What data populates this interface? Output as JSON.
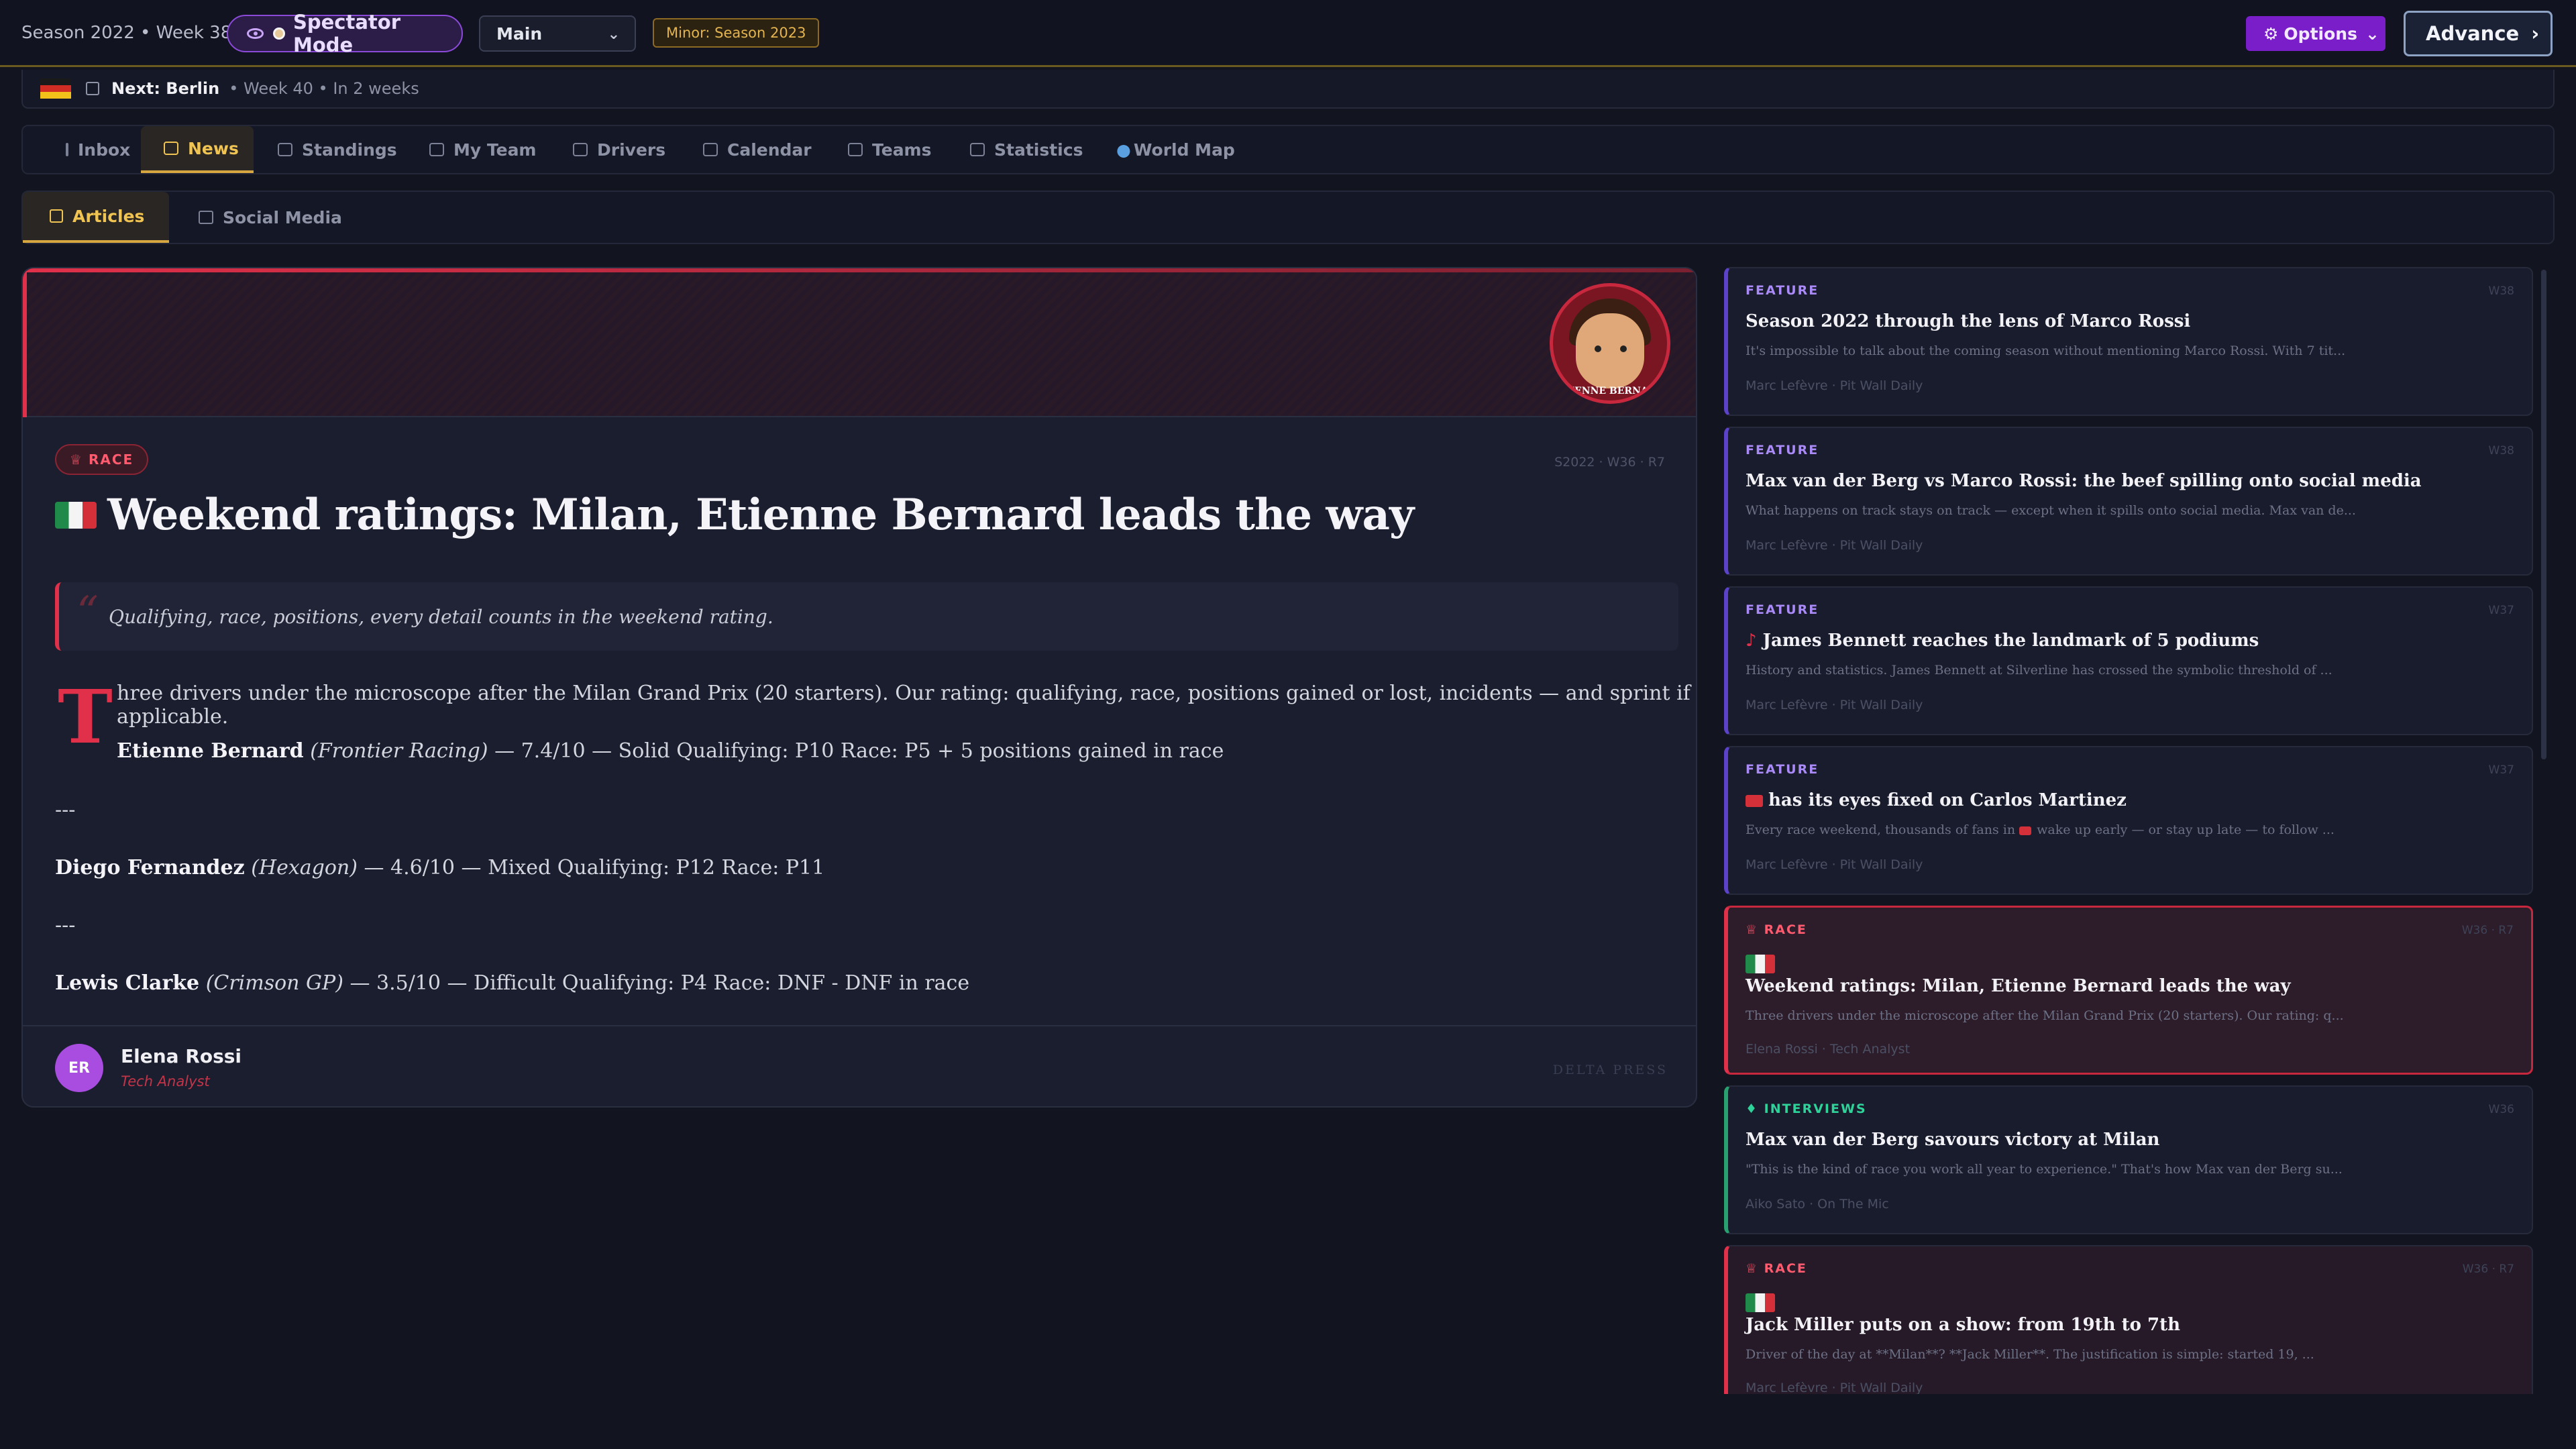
{
  "topbar": {
    "season": "Season 2022 • Week 38",
    "spectator_label": "Spectator Mode",
    "save_select": "Main",
    "minor_badge": "Minor: Season 2023",
    "options_label": "Options",
    "advance_label": "Advance"
  },
  "next_race": {
    "label": "Next: Berlin",
    "detail": "• Week 40 • In 2 weeks"
  },
  "tabs": [
    {
      "label": "Inbox"
    },
    {
      "label": "News",
      "active": true
    },
    {
      "label": "Standings"
    },
    {
      "label": "My Team"
    },
    {
      "label": "Drivers"
    },
    {
      "label": "Calendar"
    },
    {
      "label": "Teams"
    },
    {
      "label": "Statistics"
    },
    {
      "label": "World Map"
    }
  ],
  "subtabs": [
    {
      "label": "Articles",
      "active": true
    },
    {
      "label": "Social Media"
    }
  ],
  "article": {
    "category": "RACE",
    "meta": "S2022 · W36 · R7",
    "avatar_caption": "ETIENNE BERNARD",
    "headline": "Weekend ratings: Milan, Etienne Bernard leads the way",
    "quote": "Qualifying, race, positions, every detail counts in the weekend rating.",
    "dropcap": "T",
    "intro": "hree drivers under the microscope after the Milan Grand Prix (20 starters). Our rating: qualifying, race, positions gained or lost, incidents — and sprint if applicable.",
    "ratings": [
      {
        "name": "Etienne Bernard",
        "team": "(Frontier Racing)",
        "text": "— 7.4/10 — Solid Qualifying: P10 Race: P5 + 5 positions gained in race"
      },
      {
        "name": "Diego Fernandez",
        "team": "(Hexagon)",
        "text": "— 4.6/10 — Mixed Qualifying: P12 Race: P11"
      },
      {
        "name": "Lewis Clarke",
        "team": "(Crimson GP)",
        "text": "— 3.5/10 — Difficult Qualifying: P4 Race: DNF - DNF in race"
      }
    ],
    "separator": "---",
    "author_initials": "ER",
    "author_name": "Elena Rossi",
    "author_role": "Tech Analyst",
    "outlet": "DELTA PRESS"
  },
  "sidebar": [
    {
      "cat": "FEATURE",
      "week": "W38",
      "title": "Season 2022 through the lens of Marco Rossi",
      "excerpt": "It's impossible to talk about the coming season without mentioning Marco Rossi. With 7 tit...",
      "source": "Marc Lefèvre · Pit Wall Daily"
    },
    {
      "cat": "FEATURE",
      "week": "W38",
      "title": "Max van der Berg vs Marco Rossi: the beef spilling onto social media",
      "excerpt": "What happens on track stays on track — except when it spills onto social media. Max van de...",
      "source": "Marc Lefèvre · Pit Wall Daily"
    },
    {
      "cat": "FEATURE",
      "week": "W37",
      "title": "James Bennett reaches the landmark of 5 podiums",
      "excerpt": "History and statistics. James Bennett at Silverline has crossed the symbolic threshold of ...",
      "source": "Marc Lefèvre · Pit Wall Daily"
    },
    {
      "cat": "FEATURE",
      "week": "W37",
      "title": "has its eyes fixed on Carlos Martinez",
      "excerpt": "Every race weekend, thousands of fans in",
      "excerpt2": "wake up early — or stay up late — to follow ...",
      "source": "Marc Lefèvre · Pit Wall Daily"
    },
    {
      "cat": "RACE",
      "week": "W36 · R7",
      "title": "Weekend ratings: Milan, Etienne Bernard leads the way",
      "excerpt": "Three drivers under the microscope after the Milan Grand Prix (20 starters). Our rating: q...",
      "source": "Elena Rossi · Tech Analyst"
    },
    {
      "cat": "INTERVIEWS",
      "week": "W36",
      "title": "Max van der Berg savours victory at Milan",
      "excerpt": "\"This is the kind of race you work all year to experience.\" That's how Max van der Berg su...",
      "source": "Aiko Sato · On The Mic"
    },
    {
      "cat": "RACE",
      "week": "W36 · R7",
      "title": "Jack Miller puts on a show: from 19th to 7th",
      "excerpt": "Driver of the day at **Milan**? **Jack Miller**. The justification is simple: started 19, ...",
      "source": "Marc Lefèvre · Pit Wall Daily"
    }
  ],
  "colors": {
    "accent": "#e0304a",
    "gold": "#d6a640",
    "purple": "#7a1ec9"
  }
}
